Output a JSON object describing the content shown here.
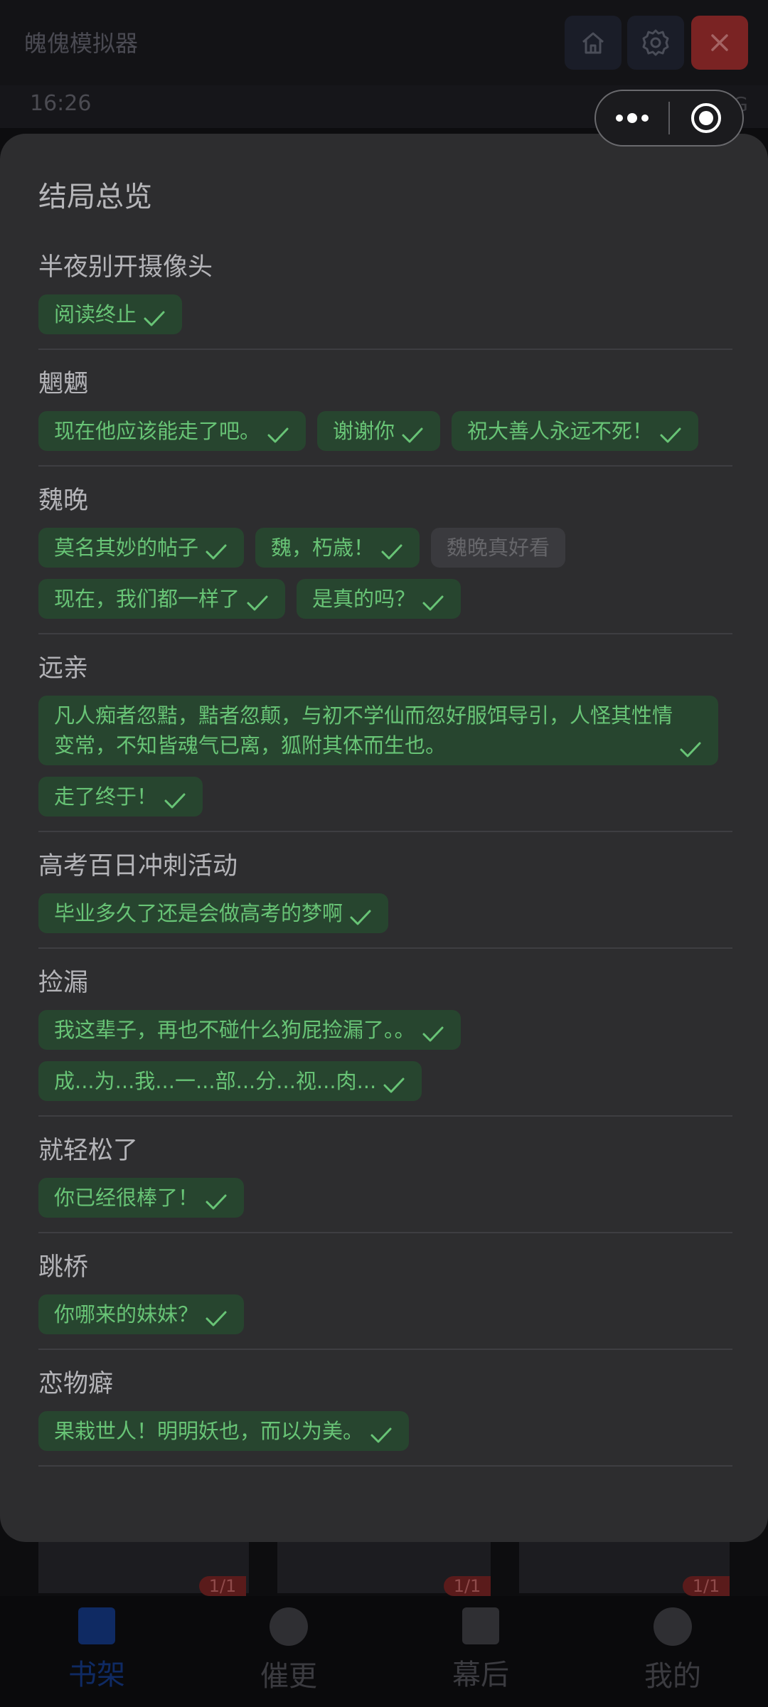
{
  "app_title": "魄傀模拟器",
  "status": {
    "time": "16:26",
    "network": "5G"
  },
  "header_buttons": [
    "home-icon",
    "gear-icon",
    "close-icon"
  ],
  "colors": {
    "chip_bg": "#27452f",
    "chip_text": "#68c476",
    "close_red": "#7a2323"
  },
  "sheet": {
    "title": "结局总览",
    "groups": [
      {
        "title": "半夜别开摄像头",
        "chips": [
          {
            "label": "阅读终止",
            "done": true
          }
        ]
      },
      {
        "title": "魍魉",
        "chips": [
          {
            "label": "现在他应该能走了吧。",
            "done": true
          },
          {
            "label": "谢谢你",
            "done": true
          },
          {
            "label": "祝大善人永远不死！",
            "done": true
          }
        ]
      },
      {
        "title": "魏晚",
        "chips": [
          {
            "label": "莫名其妙的帖子",
            "done": true
          },
          {
            "label": "魏，朽歳！",
            "done": true
          },
          {
            "label": "魏晚真好看",
            "done": false
          },
          {
            "label": "现在，我们都一样了",
            "done": true
          },
          {
            "label": "是真的吗？",
            "done": true
          }
        ]
      },
      {
        "title": "远亲",
        "chips": [
          {
            "label": "凡人痴者忽黠，黠者忽颠，与初不学仙而忽好服饵导引，人怪其性情变常，不知皆魂气已离，狐附其体而生也。",
            "done": true
          },
          {
            "label": "走了终于！",
            "done": true
          }
        ]
      },
      {
        "title": "高考百日冲刺活动",
        "chips": [
          {
            "label": "毕业多久了还是会做高考的梦啊",
            "done": true
          }
        ]
      },
      {
        "title": "捡漏",
        "chips": [
          {
            "label": "我这辈子，再也不碰什么狗屁捡漏了。。",
            "done": true
          },
          {
            "label": "成...为...我...一...部...分...视...肉...",
            "done": true
          }
        ]
      },
      {
        "title": "就轻松了",
        "chips": [
          {
            "label": "你已经很棒了！",
            "done": true
          }
        ]
      },
      {
        "title": "跳桥",
        "chips": [
          {
            "label": "你哪来的妹妹？",
            "done": true
          }
        ]
      },
      {
        "title": "恋物癖",
        "chips": [
          {
            "label": "果栽世人！明明妖也，而以为美。",
            "done": true
          }
        ]
      }
    ]
  },
  "behind_badges": [
    "1/1",
    "1/1",
    "1/1"
  ],
  "tabbar": {
    "tabs": [
      "书架",
      "催更",
      "幕后",
      "我的"
    ],
    "active": 0
  }
}
